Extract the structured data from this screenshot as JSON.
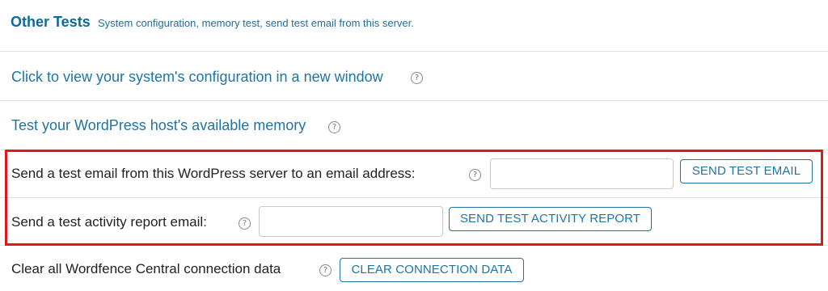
{
  "header": {
    "title": "Other Tests",
    "subtitle": "System configuration, memory test, send test email from this server."
  },
  "rows": {
    "system_config": {
      "link": "Click to view your system's configuration in a new window"
    },
    "memory_test": {
      "link": "Test your WordPress host's available memory"
    },
    "test_email": {
      "label": "Send a test email from this WordPress server to an email address:",
      "input_value": "",
      "button": "SEND TEST EMAIL"
    },
    "activity_report": {
      "label": "Send a test activity report email:",
      "input_value": "",
      "button": "SEND TEST ACTIVITY REPORT"
    },
    "clear_connection": {
      "label": "Clear all Wordfence Central connection data",
      "button": "CLEAR CONNECTION DATA"
    }
  },
  "icons": {
    "help": "?"
  },
  "colors": {
    "link": "#1f74a3",
    "title": "#0a6b9a",
    "highlight": "#e01818"
  }
}
